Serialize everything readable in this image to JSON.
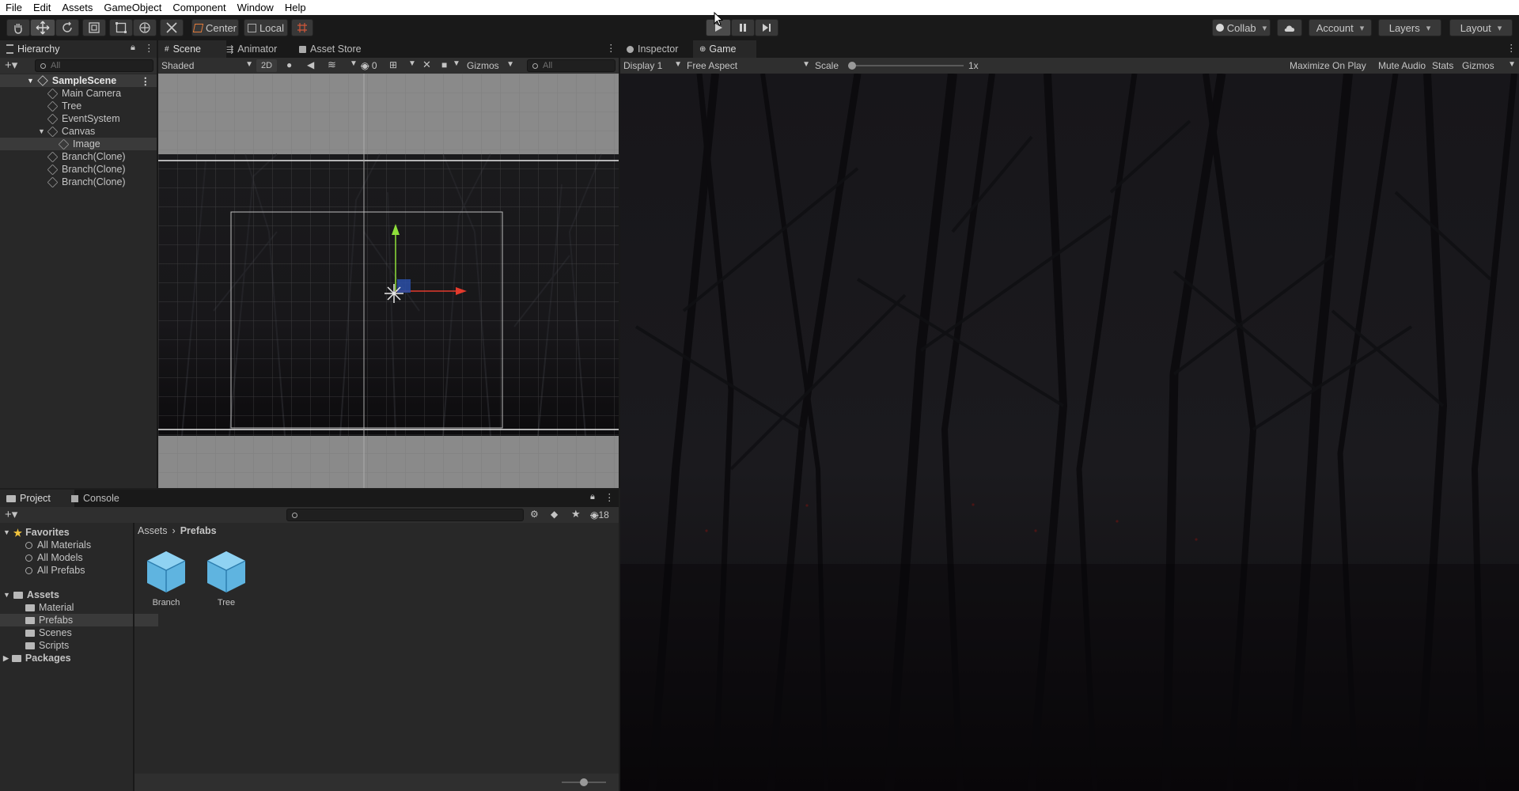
{
  "menu": [
    "File",
    "Edit",
    "Assets",
    "GameObject",
    "Component",
    "Window",
    "Help"
  ],
  "toolbar": {
    "pivot_center": "Center",
    "pivot_local": "Local",
    "collab": "Collab",
    "account": "Account",
    "layers": "Layers",
    "layout": "Layout"
  },
  "hierarchy": {
    "tab": "Hierarchy",
    "search_placeholder": "All",
    "scene": "SampleScene",
    "items": [
      {
        "label": "Main Camera"
      },
      {
        "label": "Tree"
      },
      {
        "label": "EventSystem"
      },
      {
        "label": "Canvas"
      },
      {
        "label": "Image"
      },
      {
        "label": "Branch(Clone)"
      },
      {
        "label": "Branch(Clone)"
      },
      {
        "label": "Branch(Clone)"
      }
    ]
  },
  "scene_view": {
    "tabs": [
      "Scene",
      "Animator",
      "Asset Store"
    ],
    "shading": "Shaded",
    "mode_2d": "2D",
    "hidden_count": "0",
    "gizmos": "Gizmos",
    "search_placeholder": "All"
  },
  "game_view": {
    "tabs": [
      "Inspector",
      "Game"
    ],
    "display": "Display 1",
    "aspect": "Free Aspect",
    "scale_label": "Scale",
    "scale_value": "1x",
    "scale_fraction": 0.0,
    "maximize": "Maximize On Play",
    "mute": "Mute Audio",
    "stats": "Stats",
    "gizmos": "Gizmos"
  },
  "project": {
    "tabs": [
      "Project",
      "Console"
    ],
    "hidden_count": "18",
    "favorites": {
      "label": "Favorites",
      "items": [
        "All Materials",
        "All Models",
        "All Prefabs"
      ]
    },
    "assets": {
      "label": "Assets",
      "items": [
        "Material",
        "Prefabs",
        "Scenes",
        "Scripts"
      ]
    },
    "packages": "Packages",
    "breadcrumb": {
      "root": "Assets",
      "current": "Prefabs"
    },
    "files": [
      {
        "label": "Branch"
      },
      {
        "label": "Tree"
      }
    ],
    "zoom_fraction": 0.5
  },
  "colors": {
    "accent": "#4b92d3",
    "prefab_blue": "#5fb4e0",
    "gizmo_x": "#e33a2c",
    "gizmo_y": "#8fe03b"
  }
}
